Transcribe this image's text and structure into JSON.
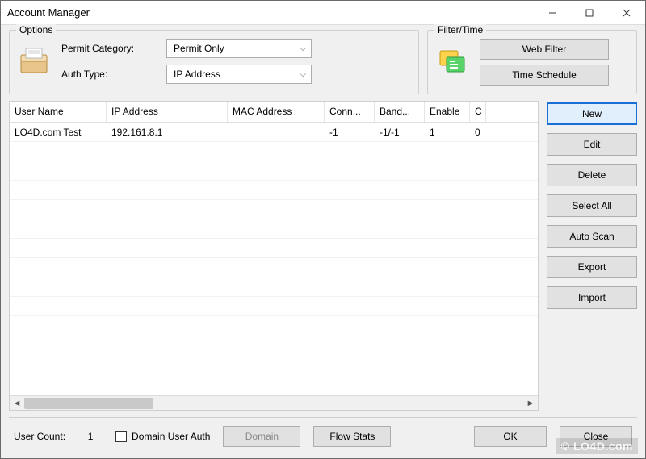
{
  "window": {
    "title": "Account Manager"
  },
  "options": {
    "label": "Options",
    "permit_label": "Permit Category:",
    "permit_value": "Permit Only",
    "auth_label": "Auth Type:",
    "auth_value": "IP Address"
  },
  "filter": {
    "label": "Filter/Time",
    "web_filter": "Web Filter",
    "time_schedule": "Time Schedule"
  },
  "table": {
    "columns": [
      "User Name",
      "IP Address",
      "MAC Address",
      "Conn...",
      "Band...",
      "Enable",
      "C"
    ],
    "rows": [
      {
        "user_name": "LO4D.com Test",
        "ip_address": "192.161.8.1",
        "mac_address": "",
        "conn": "-1",
        "band": "-1/-1",
        "enable": "1",
        "c": "0"
      }
    ]
  },
  "side": {
    "new": "New",
    "edit": "Edit",
    "delete": "Delete",
    "select_all": "Select All",
    "auto_scan": "Auto Scan",
    "export": "Export",
    "import": "Import"
  },
  "bottom": {
    "user_count_label": "User Count:",
    "user_count_value": "1",
    "domain_user_auth": "Domain User Auth",
    "domain_btn": "Domain",
    "flow_stats": "Flow Stats",
    "ok": "OK",
    "close": "Close"
  },
  "watermark": "© LO4D.com"
}
